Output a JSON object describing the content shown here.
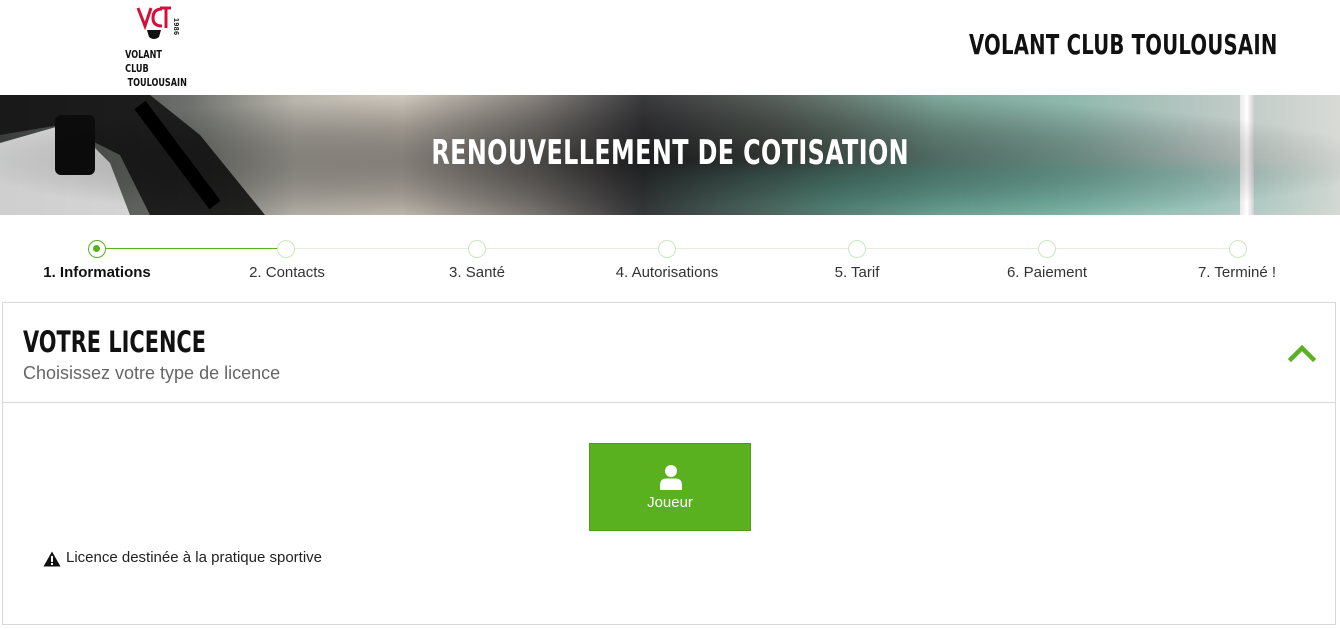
{
  "header": {
    "logo_text_line1": "VOLANT CLUB",
    "logo_text_line2": "TOULOUSAIN",
    "logo_monogram": "VCT",
    "logo_year": "1986",
    "club_name": "VOLANT CLUB TOULOUSAIN"
  },
  "banner": {
    "title": "RENOUVELLEMENT DE COTISATION"
  },
  "stepper": {
    "steps": [
      {
        "label": "1. Informations",
        "state": "active"
      },
      {
        "label": "2. Contacts",
        "state": "pending"
      },
      {
        "label": "3. Santé",
        "state": "pending"
      },
      {
        "label": "4. Autorisations",
        "state": "pending"
      },
      {
        "label": "5. Tarif",
        "state": "pending"
      },
      {
        "label": "6. Paiement",
        "state": "pending"
      },
      {
        "label": "7. Terminé !",
        "state": "pending"
      }
    ]
  },
  "licence_card": {
    "title": "VOTRE LICENCE",
    "subtitle": "Choisissez votre type de licence",
    "collapse_icon": "chevron-up-icon",
    "options": [
      {
        "label": "Joueur",
        "icon": "user-icon"
      }
    ],
    "note": "Licence destinée à la pratique sportive",
    "note_icon": "warning-icon"
  },
  "colors": {
    "accent_green": "#59b11f",
    "logo_red": "#d4103a",
    "text_dark": "#111111",
    "text_muted": "#666666"
  }
}
